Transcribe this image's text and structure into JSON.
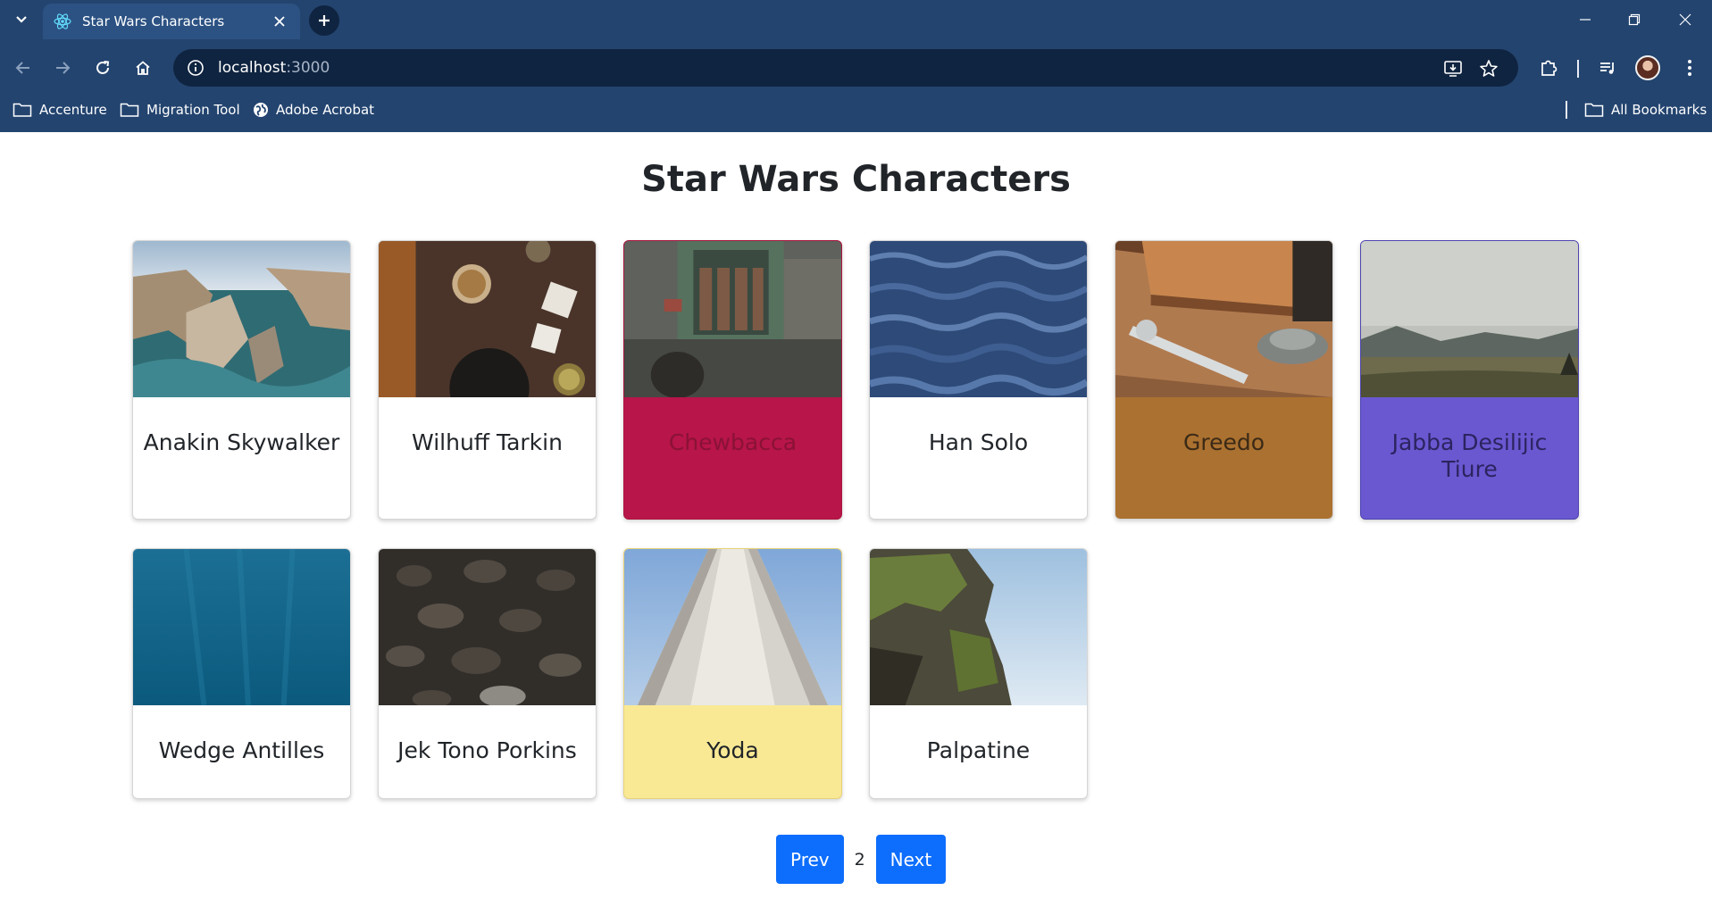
{
  "browser": {
    "tab_title": "Star Wars Characters",
    "url_host": "localhost",
    "url_port": ":3000",
    "bookmarks": [
      {
        "label": "Accenture",
        "icon": "folder-icon"
      },
      {
        "label": "Migration Tool",
        "icon": "folder-icon"
      },
      {
        "label": "Adobe Acrobat",
        "icon": "globe-icon"
      }
    ],
    "all_bookmarks_label": "All Bookmarks"
  },
  "page": {
    "title": "Star Wars Characters"
  },
  "cards": [
    {
      "name": "Anakin Skywalker",
      "body_color": "#ffffff",
      "text_color": "#212529"
    },
    {
      "name": "Wilhuff Tarkin",
      "body_color": "#ffffff",
      "text_color": "#212529"
    },
    {
      "name": "Chewbacca",
      "body_color": "#b8154a",
      "text_color": "#8a1236"
    },
    {
      "name": "Han Solo",
      "body_color": "#ffffff",
      "text_color": "#212529"
    },
    {
      "name": "Greedo",
      "body_color": "#ab7130",
      "text_color": "#3b2a16"
    },
    {
      "name": "Jabba Desilijic Tiure",
      "body_color": "#6a58d1",
      "text_color": "#2b2460"
    },
    {
      "name": "Wedge Antilles",
      "body_color": "#ffffff",
      "text_color": "#212529"
    },
    {
      "name": "Jek Tono Porkins",
      "body_color": "#ffffff",
      "text_color": "#212529"
    },
    {
      "name": "Yoda",
      "body_color": "#f9e995",
      "text_color": "#212529"
    },
    {
      "name": "Palpatine",
      "body_color": "#ffffff",
      "text_color": "#212529"
    }
  ],
  "pagination": {
    "prev_label": "Prev",
    "current_page": "2",
    "next_label": "Next"
  },
  "colors": {
    "chrome": "#23446f",
    "omnibox": "#0f2440",
    "primary_button": "#0d6efd"
  }
}
